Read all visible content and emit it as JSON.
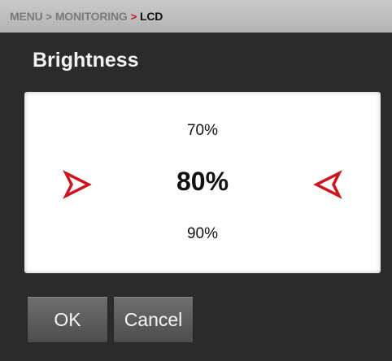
{
  "breadcrumb": {
    "items": [
      "MENU",
      "MONITORING",
      "LCD"
    ],
    "separator": ">"
  },
  "title": "Brightness",
  "picker": {
    "prev_option": "70%",
    "selected_option": "80%",
    "next_option": "90%",
    "left_arrow_icon": "red-arrow-right-icon",
    "right_arrow_icon": "red-arrow-left-icon"
  },
  "buttons": {
    "ok_label": "OK",
    "cancel_label": "Cancel"
  },
  "colors": {
    "accent_red": "#d0141e",
    "background": "#2b2b2b",
    "header_bar": "#bdbdbd",
    "button": "#5e5e5e"
  }
}
